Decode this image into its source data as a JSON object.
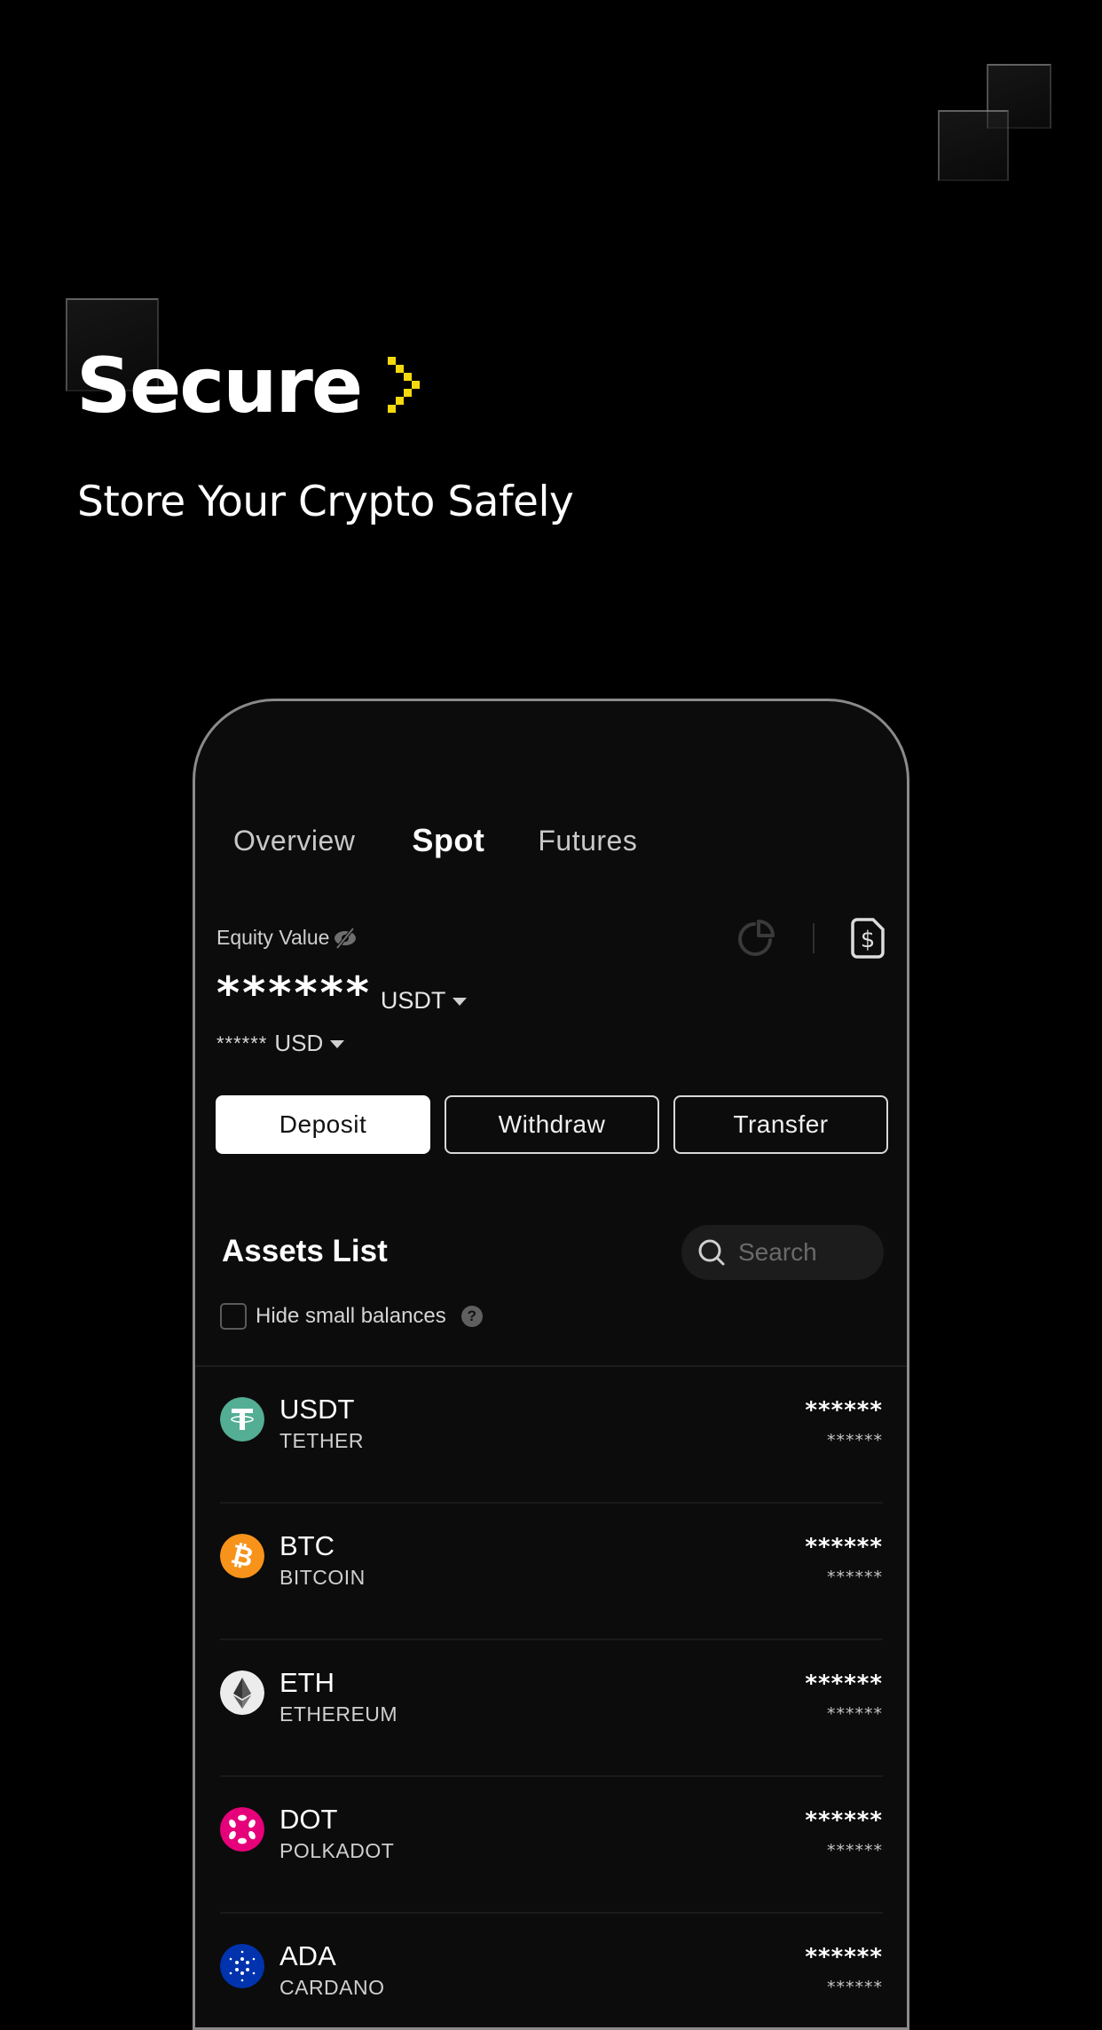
{
  "hero": {
    "title": "Secure",
    "subtitle": "Store Your Crypto Safely",
    "accent_color": "#f5d90f"
  },
  "phone": {
    "tabs": [
      {
        "label": "Overview",
        "active": false
      },
      {
        "label": "Spot",
        "active": true
      },
      {
        "label": "Futures",
        "active": false
      }
    ],
    "equity": {
      "label": "Equity Value",
      "hide_icon": "eye-off-icon",
      "value_masked": "******",
      "unit": "USDT",
      "usd_masked": "******",
      "usd_unit": "USD",
      "icons": [
        "pie-chart-icon",
        "dollar-card-icon"
      ]
    },
    "actions": {
      "deposit": "Deposit",
      "withdraw": "Withdraw",
      "transfer": "Transfer"
    },
    "assets": {
      "title": "Assets List",
      "search_placeholder": "Search",
      "hide_small_label": "Hide small balances",
      "hide_small_checked": false,
      "help_icon": "?",
      "items": [
        {
          "symbol": "USDT",
          "name": "TETHER",
          "amount": "******",
          "value": "******",
          "color": "#53ae94"
        },
        {
          "symbol": "BTC",
          "name": "BITCOIN",
          "amount": "******",
          "value": "******",
          "color": "#f7931a"
        },
        {
          "symbol": "ETH",
          "name": "ETHEREUM",
          "amount": "******",
          "value": "******",
          "color": "#ececec"
        },
        {
          "symbol": "DOT",
          "name": "POLKADOT",
          "amount": "******",
          "value": "******",
          "color": "#e6007a"
        },
        {
          "symbol": "ADA",
          "name": "CARDANO",
          "amount": "******",
          "value": "******",
          "color": "#0033ad"
        }
      ]
    }
  }
}
